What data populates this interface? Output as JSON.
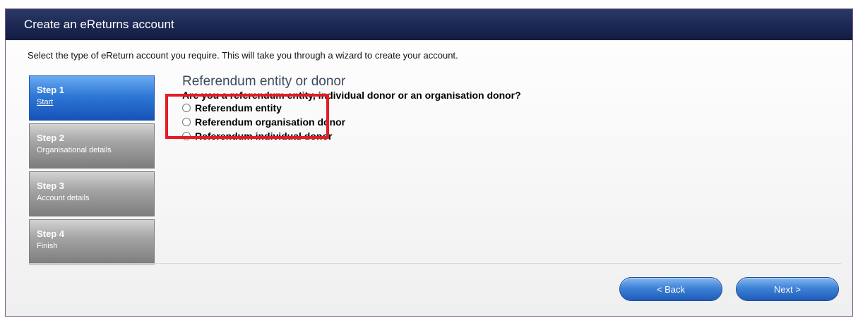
{
  "window": {
    "title": "Create an eReturns account"
  },
  "intro": "Select the type of eReturn account you require. This will take you through a wizard to create your account.",
  "steps": [
    {
      "number": "Step 1",
      "label": "Start",
      "active": true
    },
    {
      "number": "Step 2",
      "label": "Organisational details",
      "active": false
    },
    {
      "number": "Step 3",
      "label": "Account details",
      "active": false
    },
    {
      "number": "Step 4",
      "label": "Finish",
      "active": false
    }
  ],
  "form": {
    "heading": "Referendum entity or donor",
    "question": "Are you a referendum entity, individual donor or an organisation donor?",
    "options": [
      "Referendum entity",
      "Referendum organisation donor",
      "Referendum individual donor"
    ]
  },
  "buttons": {
    "back": "< Back",
    "next": "Next >"
  },
  "colors": {
    "highlight": "#e51c23",
    "title_bar": "#1a2650",
    "active_step": "#2e78d6"
  }
}
